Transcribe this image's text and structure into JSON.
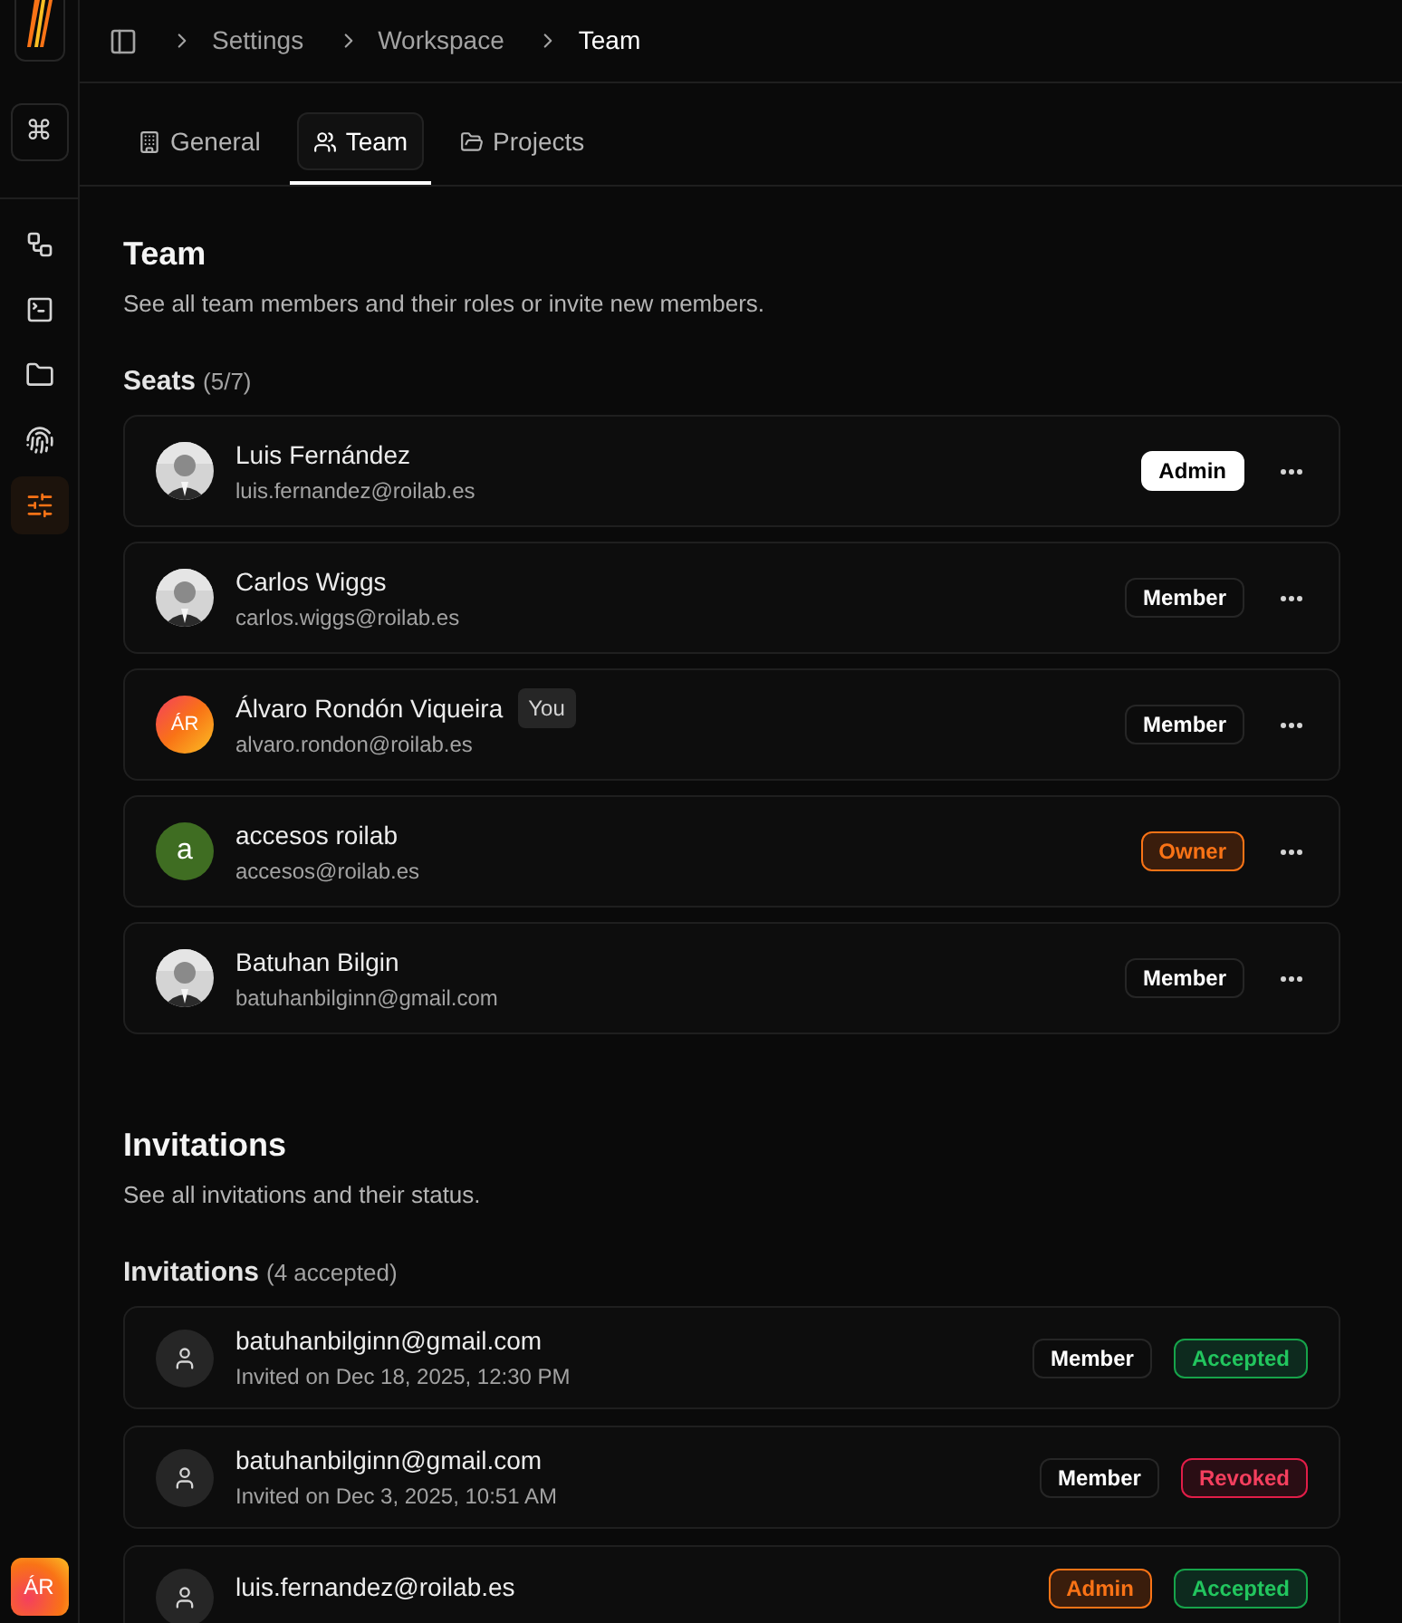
{
  "sidebar": {
    "command_key": "⌘",
    "items": [
      {
        "selected": false
      },
      {
        "selected": false
      },
      {
        "selected": false
      },
      {
        "selected": false
      },
      {
        "selected": true
      }
    ],
    "user_initials": "ÁR"
  },
  "breadcrumb": [
    "Settings",
    "Workspace",
    "Team"
  ],
  "tabs": [
    {
      "label": "General",
      "selected": false
    },
    {
      "label": "Team",
      "selected": true
    },
    {
      "label": "Projects",
      "selected": false
    }
  ],
  "team": {
    "title": "Team",
    "description": "See all team members and their roles or invite new members.",
    "seats_label": "Seats",
    "seats_count": "(5/7)",
    "members": [
      {
        "name": "Luis Fernández",
        "email": "luis.fernandez@roilab.es",
        "role": {
          "text": "Admin",
          "kind": "admin"
        }
      },
      {
        "name": "Carlos Wiggs",
        "email": "carlos.wiggs@roilab.es",
        "role": {
          "text": "Member",
          "kind": "member"
        }
      },
      {
        "name": "Álvaro Rondón Viqueira",
        "you_badge": "You",
        "email": "alvaro.rondon@roilab.es",
        "avatar": {
          "kind": "initials",
          "text": "ÁR"
        },
        "role": {
          "text": "Member",
          "kind": "member"
        }
      },
      {
        "name": "accesos roilab",
        "email": "accesos@roilab.es",
        "avatar": {
          "kind": "letter",
          "text": "a"
        },
        "role": {
          "text": "Owner",
          "kind": "owner"
        }
      },
      {
        "name": "Batuhan Bilgin",
        "email": "batuhanbilginn@gmail.com",
        "role": {
          "text": "Member",
          "kind": "member"
        }
      }
    ]
  },
  "invitations": {
    "title": "Invitations",
    "description": "See all invitations and their status.",
    "list_label": "Invitations",
    "list_count": "(4 accepted)",
    "items": [
      {
        "email": "batuhanbilginn@gmail.com",
        "invited": "Invited on Dec 18, 2025, 12:30 PM",
        "role": {
          "text": "Member",
          "kind": "member"
        },
        "status": {
          "text": "Accepted",
          "kind": "accepted"
        }
      },
      {
        "email": "batuhanbilginn@gmail.com",
        "invited": "Invited on Dec 3, 2025, 10:51 AM",
        "role": {
          "text": "Member",
          "kind": "member"
        },
        "status": {
          "text": "Revoked",
          "kind": "revoked"
        }
      },
      {
        "email": "luis.fernandez@roilab.es",
        "role": {
          "text": "Admin",
          "kind": "owner"
        },
        "status": {
          "text": "Accepted",
          "kind": "accepted"
        }
      }
    ]
  }
}
